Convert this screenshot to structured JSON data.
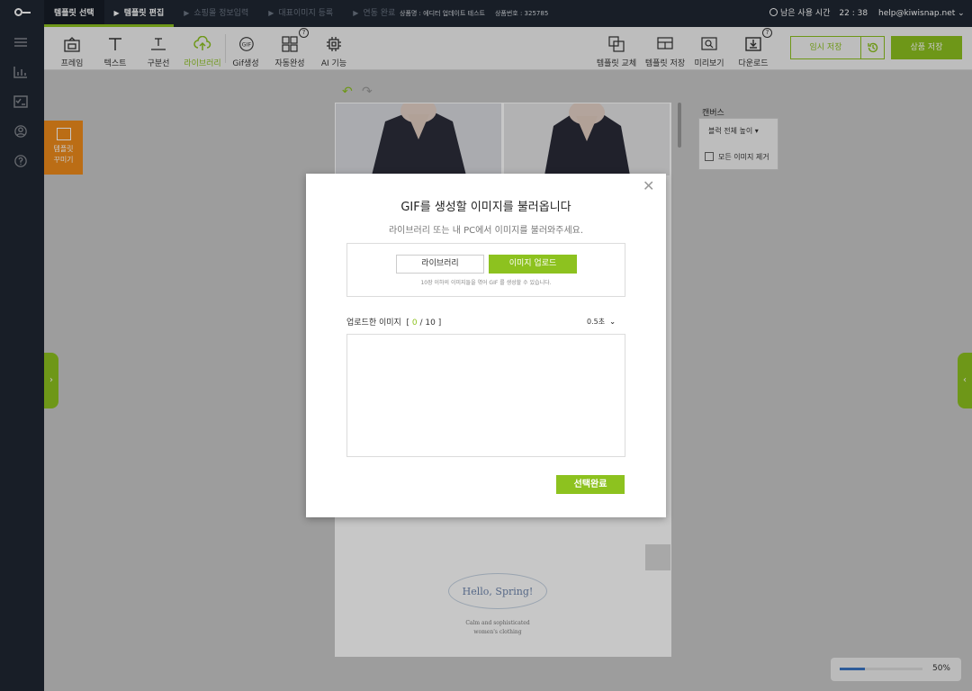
{
  "topbar": {
    "steps": [
      {
        "label": "템플릿 선택",
        "state": "done"
      },
      {
        "label": "템플릿 편집",
        "state": "active"
      },
      {
        "label": "쇼핑몰 정보입력",
        "state": "todo"
      },
      {
        "label": "대표이미지 등록",
        "state": "todo"
      },
      {
        "label": "연동 완료",
        "state": "todo"
      }
    ],
    "product_name": "상품명 : 에디터 업데이트 테스트",
    "product_no": "상품번호 : 325785",
    "remaining_label": "남은 사용 시간",
    "remaining_time": "22 : 38",
    "email": "help@kiwisnap.net"
  },
  "sidebar": {
    "icons": [
      "list-icon",
      "chart-icon",
      "checklist-icon",
      "user-icon",
      "help-icon"
    ]
  },
  "toolbar": {
    "frame": "프레임",
    "text": "텍스트",
    "divider": "구분선",
    "library": "라이브러리",
    "gif": "Gif생성",
    "auto": "자동완성",
    "ai": "AI 기능",
    "template_swap": "템플릿 교체",
    "template_save": "템플릿 저장",
    "preview": "미리보기",
    "download": "다운로드",
    "help_mark": "?",
    "temp_save": "임시 저장",
    "product_save": "상품 저장"
  },
  "deco": {
    "label_1": "템플릿",
    "label_2": "꾸미기"
  },
  "canvas_panel": {
    "title": "캔버스",
    "block_height": "블럭 전체 높이",
    "remove_images": "모든 이미지 제거"
  },
  "canvas": {
    "spring_title": "Hello, Spring!",
    "spring_sub_1": "Calm and sophisticated",
    "spring_sub_2": "women's clothing"
  },
  "zoom": {
    "label": "50%",
    "value": 0.5
  },
  "modal": {
    "title": "GIF를 생성할 이미지를 불러옵니다",
    "subtitle": "라이브러리 또는 내 PC에서 이미지를 불러와주세요.",
    "library_button": "라이브러리",
    "upload_button": "이미지 업로드",
    "note": "10장 이하의 이미지들을 엮어 GIF 를 생성할 수 있습니다.",
    "uploaded_label": "업로드한 이미지",
    "count_current": "0",
    "count_max": "10",
    "speed": "0.5초",
    "confirm": "선택완료"
  },
  "colors": {
    "accent": "#8dc21f",
    "dark": "#1f2733",
    "orange": "#f08c1b"
  }
}
